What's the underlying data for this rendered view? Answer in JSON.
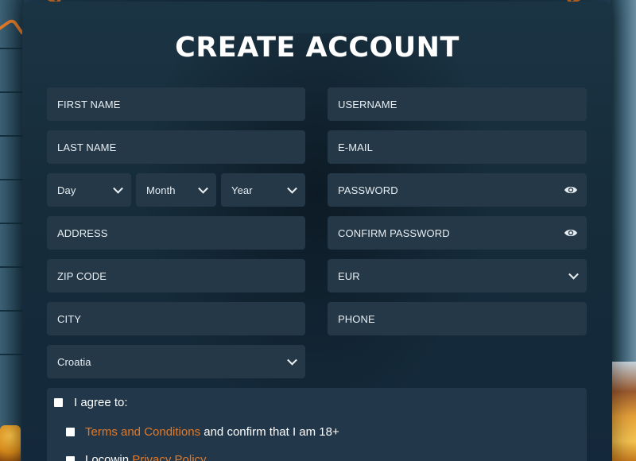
{
  "title": "CREATE ACCOUNT",
  "form": {
    "first_name": "FIRST NAME",
    "last_name": "LAST NAME",
    "day": "Day",
    "month": "Month",
    "year": "Year",
    "address": "ADDRESS",
    "zip_code": "ZIP CODE",
    "city": "CITY",
    "country": "Croatia",
    "username": "USERNAME",
    "email": "E-MAIL",
    "password": "PASSWORD",
    "confirm_password": "CONFIRM PASSWORD",
    "currency": "EUR",
    "phone": "PHONE"
  },
  "agree": {
    "intro": "I agree to:",
    "terms_link": "Terms and Conditions",
    "terms_suffix": " and confirm that I am 18+",
    "privacy_prefix": "Locowin ",
    "privacy_link": "Privacy Policy"
  },
  "colors": {
    "accent": "#e07a2a",
    "field_bg": "#243847",
    "panel_bg": "#1b3444"
  },
  "icons": {
    "eye": "eye-icon",
    "chevron": "chevron-down-icon",
    "checkbox": "checkbox"
  }
}
